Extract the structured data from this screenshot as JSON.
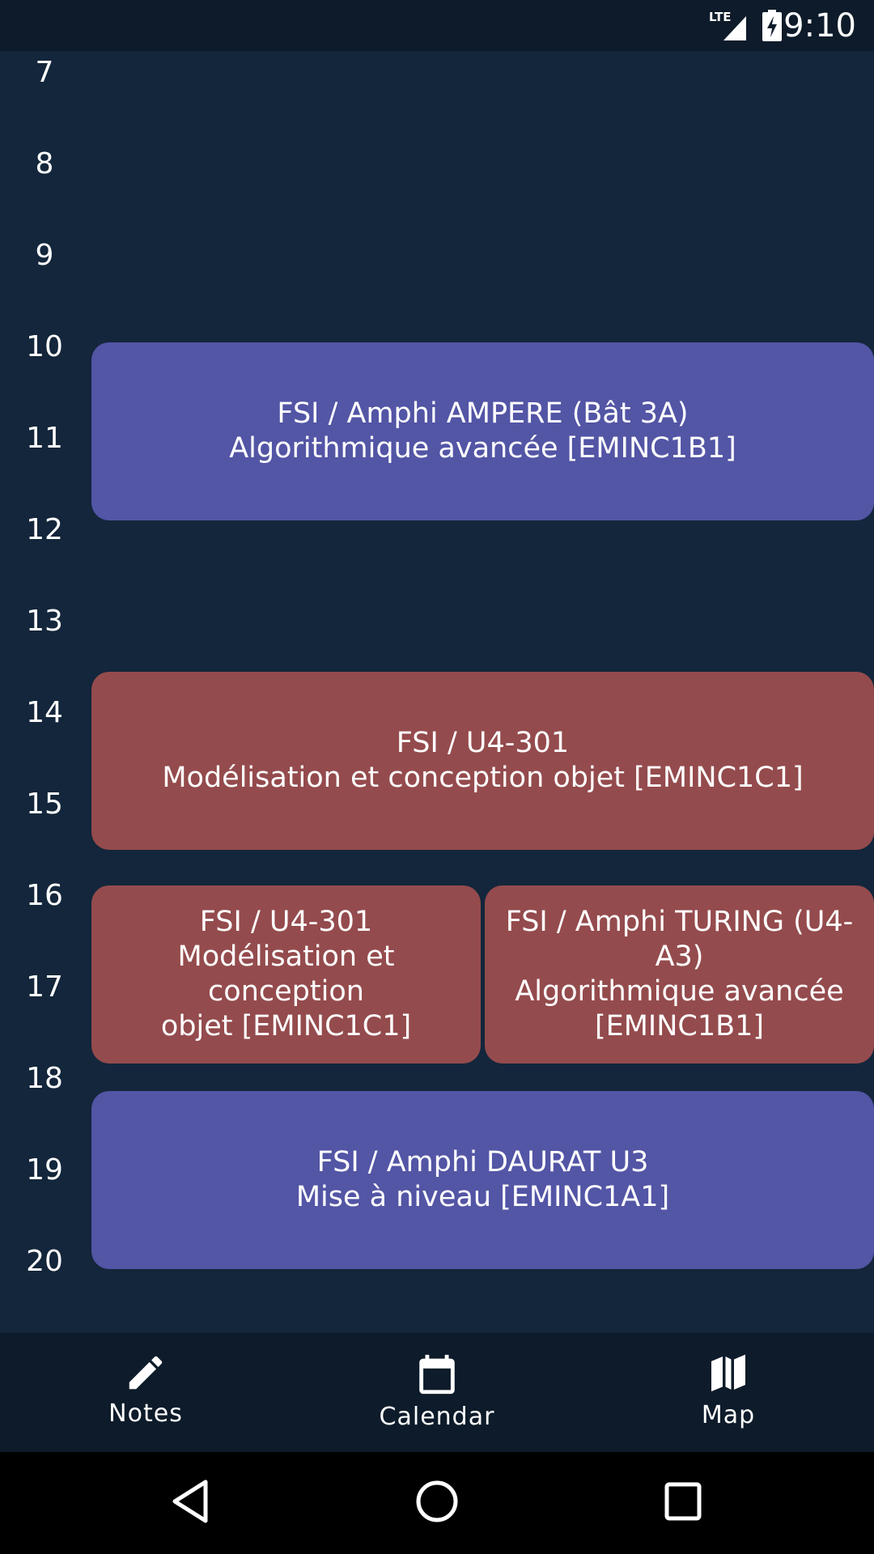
{
  "status_bar": {
    "network": "LTE",
    "time": "9:10"
  },
  "hours": [
    "7",
    "8",
    "9",
    "10",
    "11",
    "12",
    "13",
    "14",
    "15",
    "16",
    "17",
    "18",
    "19",
    "20"
  ],
  "events": [
    {
      "line1": "FSI / Amphi AMPERE (Bât 3A)",
      "line2": "Algorithmique avancée [EMINC1B1]",
      "color": "#5355a5"
    },
    {
      "line1": "FSI / U4-301",
      "line2": "Modélisation et conception objet [EMINC1C1]",
      "color": "#944b4d"
    },
    {
      "line1": "FSI / U4-301",
      "line2": "Modélisation et conception",
      "line3": "objet [EMINC1C1]",
      "color": "#944b4d"
    },
    {
      "line1": "FSI / Amphi TURING (U4-A3)",
      "line2": "Algorithmique avancée",
      "line3": "[EMINC1B1]",
      "color": "#944b4d"
    },
    {
      "line1": "FSI / Amphi DAURAT U3",
      "line2": "Mise à  niveau [EMINC1A1]",
      "color": "#5355a5"
    }
  ],
  "bottom_nav": {
    "items": [
      {
        "label": "Notes",
        "icon": "pencil-icon"
      },
      {
        "label": "Calendar",
        "icon": "calendar-icon"
      },
      {
        "label": "Map",
        "icon": "map-icon"
      }
    ]
  },
  "colors": {
    "background": "#13263b",
    "bars": "#0d1b2a",
    "event_blue": "#5355a5",
    "event_red": "#944b4d"
  }
}
